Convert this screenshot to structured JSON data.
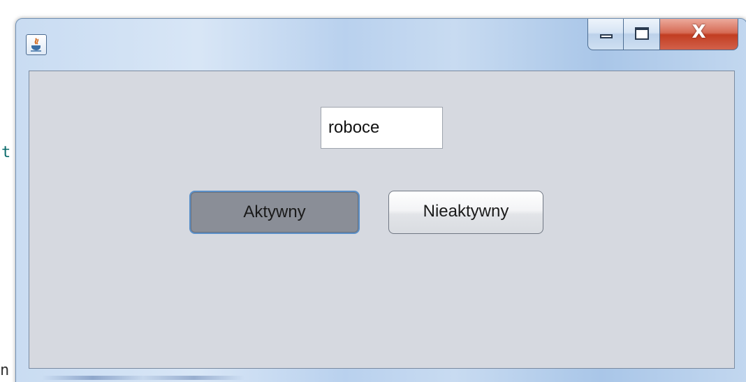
{
  "background": {
    "left_glyph_top": "t",
    "left_glyph_bottom": "n"
  },
  "window": {
    "app_icon": "java-cup-icon",
    "caption_buttons": {
      "minimize": "minimize-icon",
      "maximize": "maximize-icon",
      "close_label": "X"
    }
  },
  "form": {
    "text_value": "roboce",
    "active_button_label": "Aktywny",
    "inactive_button_label": "Nieaktywny"
  },
  "colors": {
    "content_bg": "#d6d9e0",
    "active_button_bg": "#8a8e97",
    "focus_ring": "#5b8fc7",
    "close_button_red": "#c23d22"
  }
}
